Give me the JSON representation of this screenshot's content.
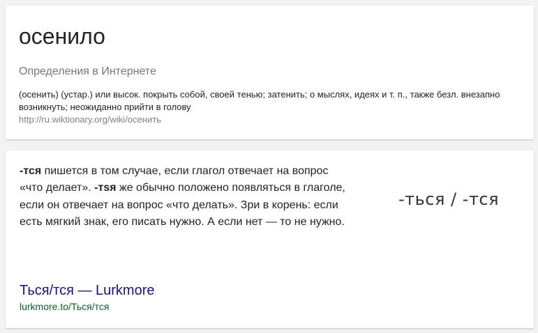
{
  "definition_card": {
    "word": "осенило",
    "subtitle": "Определения в Интернете",
    "definition": "(осенить) (устар.) или высок. покрыть собой, своей тенью; затенить; о мыслях, идеях и т. п., также безл. внезапно возникнуть; неожиданно прийти в голову",
    "source": "http://ru.wiktionary.org/wiki/осенить"
  },
  "snippet_card": {
    "bold_1": "-тся",
    "text_1": " пишется в том случае, если глагол отвечает на вопрос «что делает». ",
    "bold_2": "-тsя",
    "text_2": " же обычно положено появляться в глаголе, если он отвечает на вопрос «что делать». Зри в корень: если есть мягкий знак, его писать нужно. А если нет — то не нужно.",
    "image_caption": "-ться / -тся",
    "result_title": "Ться/тся — Lurkmore",
    "result_url": "lurkmore.to/Ться/тся"
  }
}
